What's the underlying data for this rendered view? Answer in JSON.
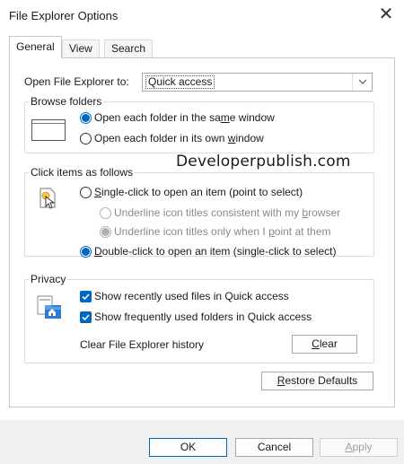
{
  "window": {
    "title": "File Explorer Options",
    "close_label": "✕"
  },
  "tabs": [
    {
      "label": "General",
      "active": true
    },
    {
      "label": "View",
      "active": false
    },
    {
      "label": "Search",
      "active": false
    }
  ],
  "open_to": {
    "label": "Open File Explorer to:",
    "value": "Quick access"
  },
  "browse_folders": {
    "title": "Browse folders",
    "options": [
      {
        "label_pre": "Open each folder in the sa",
        "label_u": "m",
        "label_post": "e window",
        "checked": true
      },
      {
        "label_pre": "Open each folder in its own ",
        "label_u": "w",
        "label_post": "indow",
        "checked": false
      }
    ]
  },
  "click_items": {
    "title": "Click items as follows",
    "single": {
      "label_pre": "",
      "label_u": "S",
      "label_post": "ingle-click to open an item (point to select)",
      "checked": false
    },
    "sub_options": [
      {
        "label_pre": "Underline icon titles consistent with my ",
        "label_u": "b",
        "label_post": "rowser",
        "checked": false
      },
      {
        "label_pre": "Underline icon titles only when I ",
        "label_u": "p",
        "label_post": "oint at them",
        "checked": true
      }
    ],
    "double": {
      "label_pre": "",
      "label_u": "D",
      "label_post": "ouble-click to open an item (single-click to select)",
      "checked": true
    }
  },
  "watermark": "Developerpublish.com",
  "privacy": {
    "title": "Privacy",
    "options": [
      {
        "label": "Show recently used files in Quick access",
        "checked": true
      },
      {
        "label": "Show frequently used folders in Quick access",
        "checked": true
      }
    ],
    "clear_history_label": "Clear File Explorer history",
    "clear_button": {
      "label_u": "C",
      "label_post": "lear"
    }
  },
  "restore_defaults": {
    "label_u": "R",
    "label_post": "estore Defaults"
  },
  "footer": {
    "ok": "OK",
    "cancel": "Cancel",
    "apply_u": "A",
    "apply_post": "pply"
  },
  "colors": {
    "accent": "#0067c0",
    "footer_bg": "#f0f0f0"
  }
}
